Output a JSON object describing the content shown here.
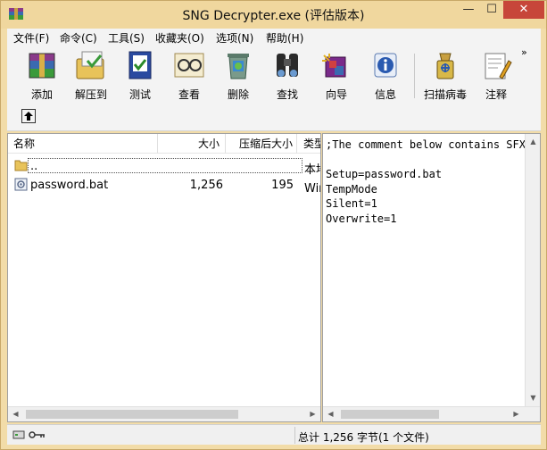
{
  "window": {
    "title": "SNG Decrypter.exe (评估版本)",
    "min_glyph": "—",
    "max_glyph": "☐",
    "close_glyph": "✕"
  },
  "menu": [
    {
      "label": "文件(F)"
    },
    {
      "label": "命令(C)"
    },
    {
      "label": "工具(S)"
    },
    {
      "label": "收藏夹(O)"
    },
    {
      "label": "选项(N)"
    },
    {
      "label": "帮助(H)"
    }
  ],
  "toolbar": {
    "buttons": [
      {
        "label": "添加",
        "icon": "add-archive-icon"
      },
      {
        "label": "解压到",
        "icon": "extract-to-icon"
      },
      {
        "label": "测试",
        "icon": "test-icon"
      },
      {
        "label": "查看",
        "icon": "view-icon"
      },
      {
        "label": "删除",
        "icon": "delete-icon"
      },
      {
        "label": "查找",
        "icon": "find-icon"
      },
      {
        "label": "向导",
        "icon": "wizard-icon"
      },
      {
        "label": "信息",
        "icon": "info-icon"
      },
      {
        "label": "扫描病毒",
        "icon": "virus-scan-icon"
      },
      {
        "label": "注释",
        "icon": "comment-icon"
      }
    ],
    "more_glyph": "»"
  },
  "file_list": {
    "columns": [
      "名称",
      "大小",
      "压缩后大小",
      "类型"
    ],
    "rows": [
      {
        "name": "..",
        "size": "",
        "packed": "",
        "type": "本地磁盘"
      },
      {
        "name": "password.bat",
        "size": "1,256",
        "packed": "195",
        "type": "Windows 批处理文件"
      }
    ]
  },
  "comment": {
    "text": ";The comment below contains SFX script commands\n\nSetup=password.bat\nTempMode\nSilent=1\nOverwrite=1"
  },
  "status": {
    "text": "总计 1,256 字节(1 个文件)"
  },
  "colors": {
    "frame": "#f2dca8",
    "close": "#c7463a"
  }
}
